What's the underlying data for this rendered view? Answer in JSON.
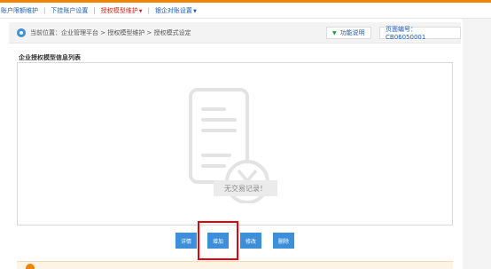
{
  "topnav": {
    "items": [
      {
        "label": "账户限额维护",
        "active": false,
        "dropdown": false
      },
      {
        "label": "下挂账户设置",
        "active": false,
        "dropdown": false
      },
      {
        "label": "授权模型维护",
        "active": true,
        "dropdown": true
      },
      {
        "label": "银企对账设置",
        "active": false,
        "dropdown": true
      }
    ],
    "separator": "|",
    "caret": "▼"
  },
  "breadcrumb": {
    "text": "当前位置：企业管理平台 > 授权模型维护 > 授权模式设定"
  },
  "function_button": {
    "icon": "chevron-down-icon",
    "label": "功能说明"
  },
  "page_number": {
    "label": "页面编号：CB06050001"
  },
  "section": {
    "title": "企业授权模型信息列表"
  },
  "empty_state": {
    "message": "无交易记录！",
    "icon": "document-yuan-icon"
  },
  "actions": [
    {
      "label": "详情"
    },
    {
      "label": "增加"
    },
    {
      "label": "修改"
    },
    {
      "label": "删除"
    }
  ],
  "colors": {
    "accent_blue": "#3d8fd9",
    "link_blue": "#1f5fb0",
    "active_red": "#d8271c",
    "highlight_red": "#e8000b",
    "brand_orange": "#f08300"
  }
}
